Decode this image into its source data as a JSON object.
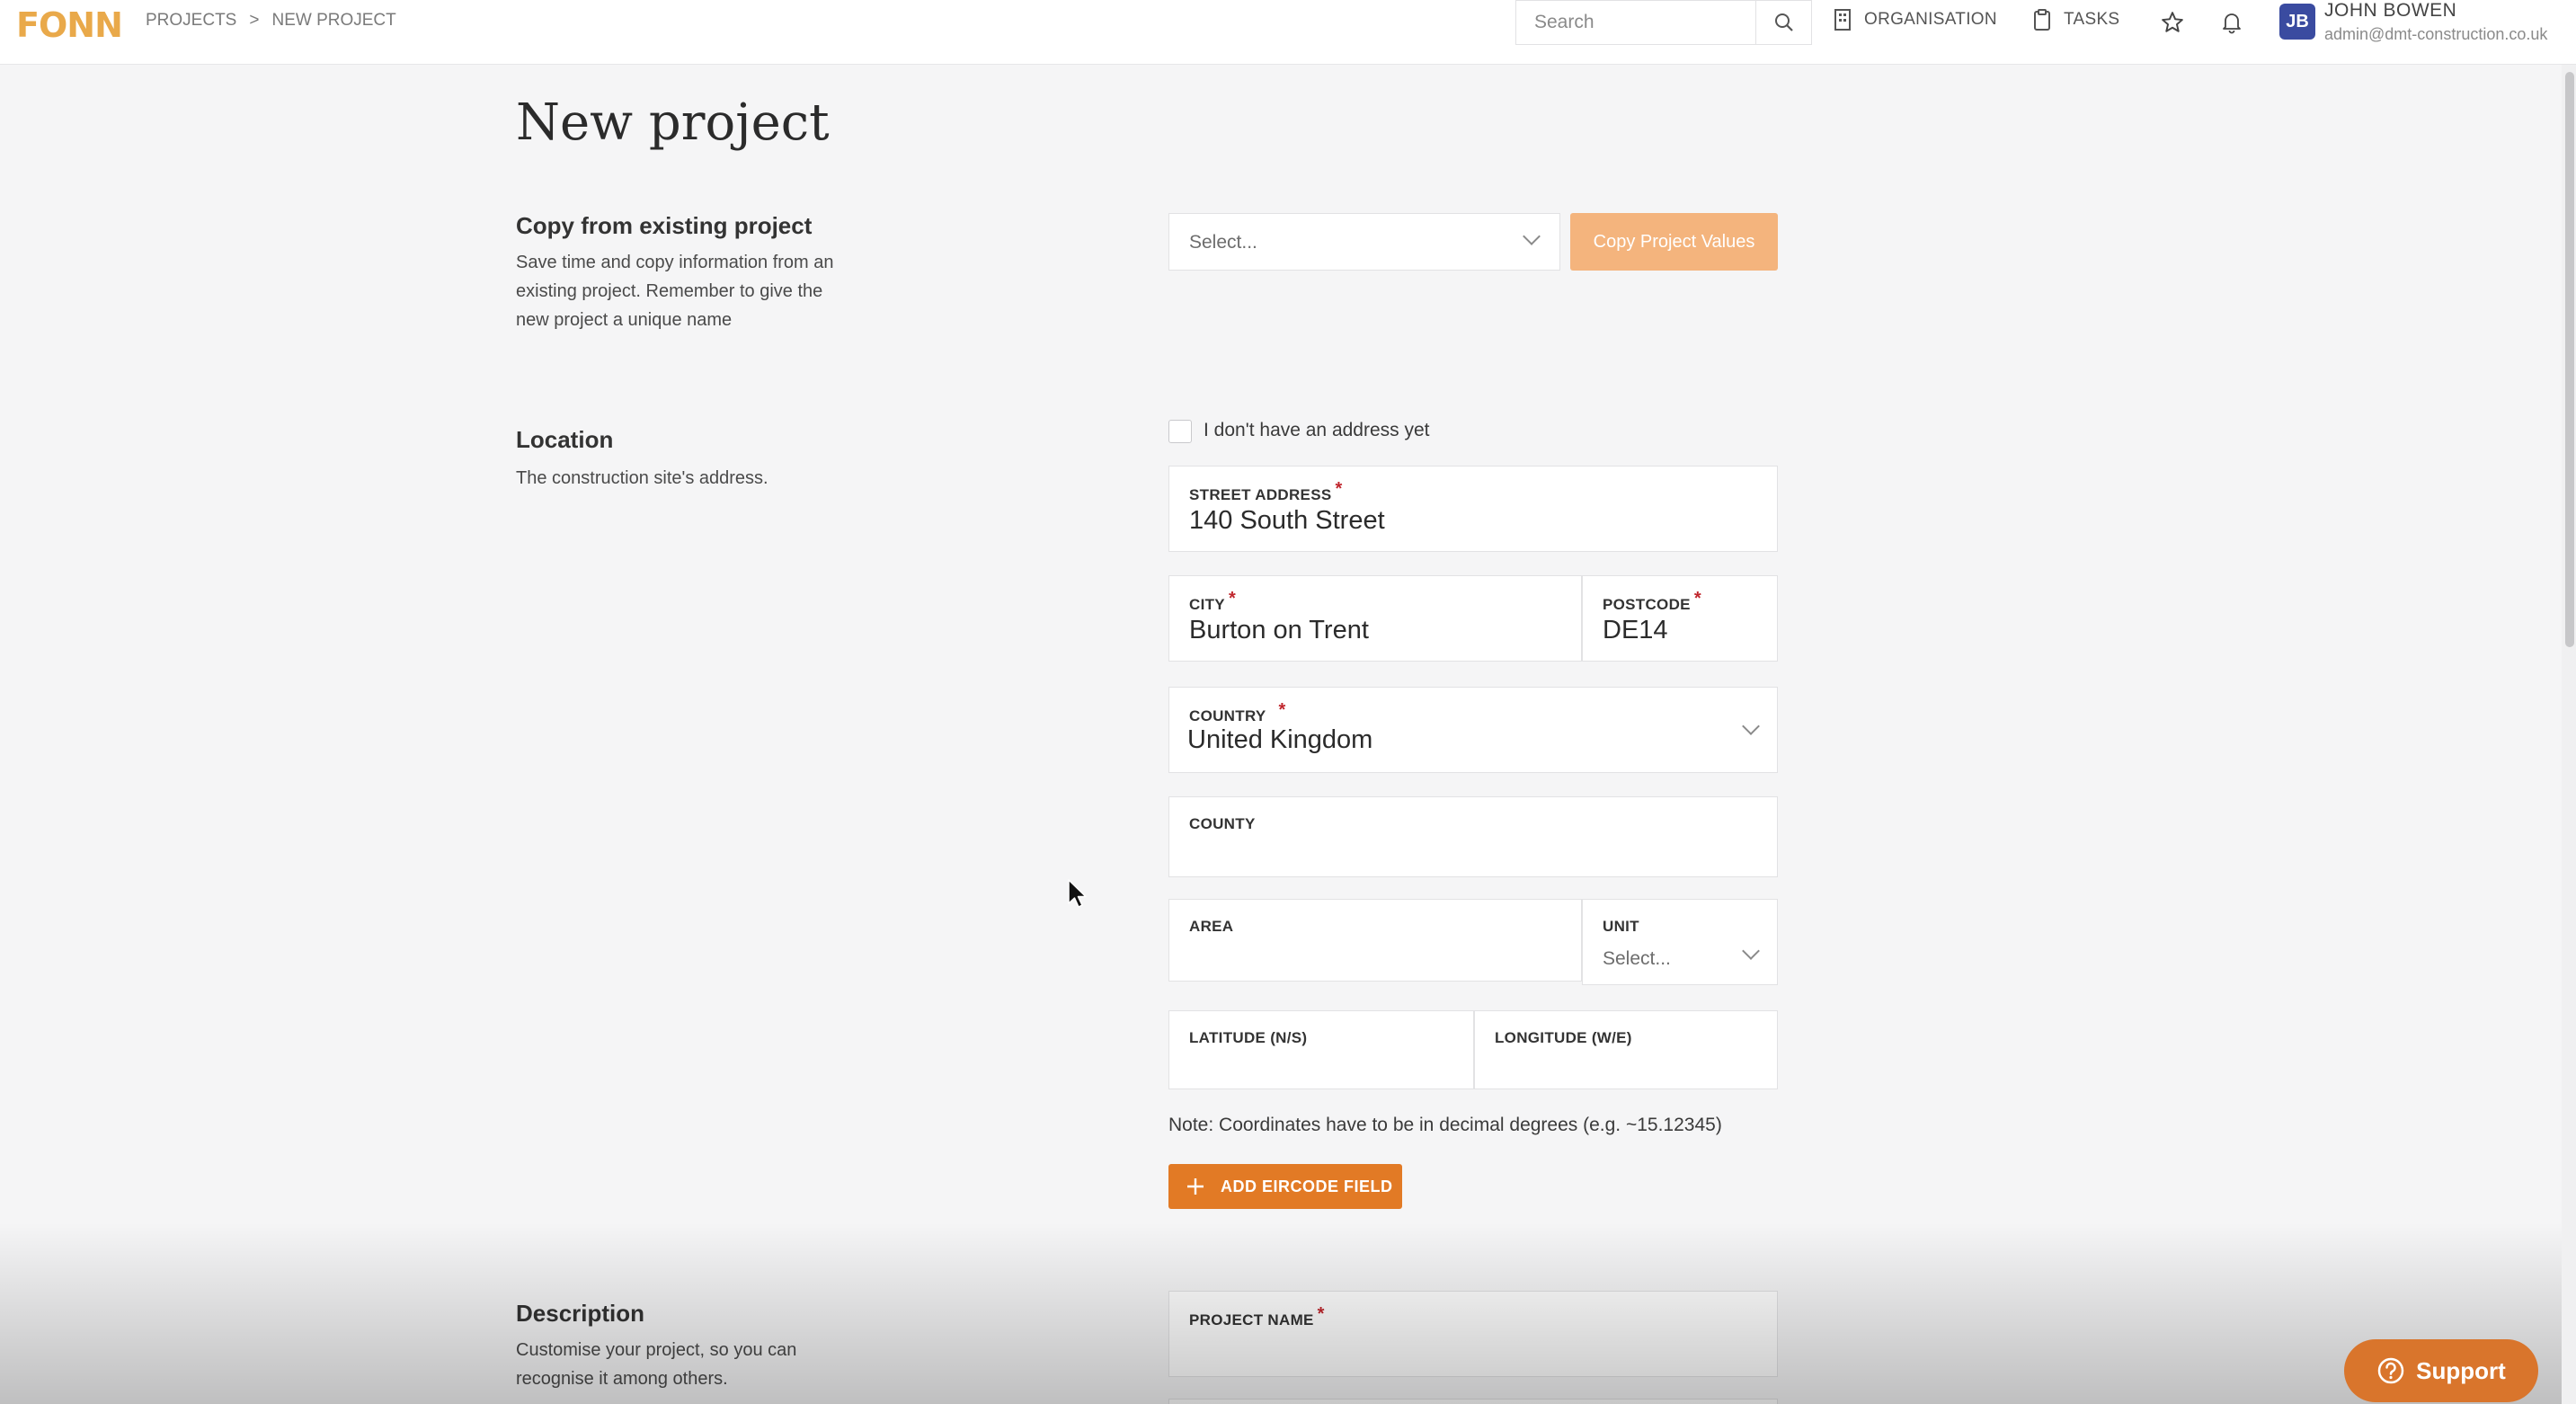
{
  "header": {
    "logo": "FONN",
    "breadcrumb": [
      "PROJECTS",
      ">",
      "NEW PROJECT"
    ],
    "search_placeholder": "Search",
    "nav": {
      "organisation": "ORGANISATION",
      "tasks": "TASKS"
    },
    "user": {
      "initials": "JB",
      "name": "JOHN BOWEN",
      "email": "admin@dmt-construction.co.uk"
    }
  },
  "page": {
    "title": "New project"
  },
  "copy_section": {
    "title": "Copy from existing project",
    "description": [
      "Save time and copy information from an",
      "existing project. Remember to give the",
      "new project a unique name"
    ],
    "select_placeholder": "Select...",
    "button": "Copy Project Values"
  },
  "location_section": {
    "title": "Location",
    "description": "The construction site's address.",
    "no_address_label": "I don't have an address yet",
    "fields": {
      "street": {
        "label": "STREET ADDRESS",
        "value": "140 South Street"
      },
      "city": {
        "label": "CITY",
        "value": "Burton on Trent"
      },
      "postcode": {
        "label": "POSTCODE",
        "value": "DE14"
      },
      "country": {
        "label": "COUNTRY",
        "value": "United Kingdom"
      },
      "county": {
        "label": "COUNTY",
        "value": ""
      },
      "area": {
        "label": "AREA",
        "value": ""
      },
      "unit": {
        "label": "UNIT",
        "placeholder": "Select..."
      },
      "latitude": {
        "label": "LATITUDE (N/S)",
        "value": ""
      },
      "longitude": {
        "label": "LONGITUDE (W/E)",
        "value": ""
      }
    },
    "note": "Note: Coordinates have to be in decimal degrees (e.g. ~15.12345)",
    "add_eircode": "ADD EIRCODE FIELD"
  },
  "description_section": {
    "title": "Description",
    "description": [
      "Customise your project, so you can",
      "recognise it among others."
    ],
    "project_name_label": "PROJECT NAME"
  },
  "support": {
    "label": "Support"
  },
  "colors": {
    "accent": "#e27a25",
    "copy_button": "#f4b47d",
    "required": "#c0262d",
    "avatar": "#3a4ba0",
    "logo": "#e9a94a"
  }
}
